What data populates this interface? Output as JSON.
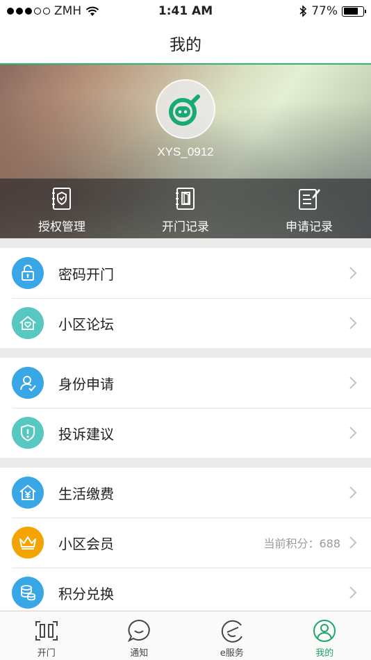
{
  "status_bar": {
    "carrier": "ZMH",
    "time": "1:41 AM",
    "battery": "77%",
    "battery_level": 0.77,
    "signal_bars": 3
  },
  "nav": {
    "title": "我的"
  },
  "profile": {
    "username": "XYS_0912",
    "quick_actions": [
      {
        "label": "授权管理",
        "icon": "auth-manage-icon"
      },
      {
        "label": "开门记录",
        "icon": "door-record-icon"
      },
      {
        "label": "申请记录",
        "icon": "apply-record-icon"
      }
    ]
  },
  "groups": [
    [
      {
        "label": "密码开门",
        "icon": "lock-open-icon",
        "color": "#39a7e6"
      },
      {
        "label": "小区论坛",
        "icon": "home-heart-icon",
        "color": "#57c7c1"
      }
    ],
    [
      {
        "label": "身份申请",
        "icon": "user-check-icon",
        "color": "#39a7e6"
      },
      {
        "label": "投诉建议",
        "icon": "shield-alert-icon",
        "color": "#57c7c1"
      }
    ],
    [
      {
        "label": "生活缴费",
        "icon": "house-yen-icon",
        "color": "#39a7e6"
      },
      {
        "label": "小区会员",
        "icon": "crown-icon",
        "color": "#f5a300",
        "extra": "当前积分：688"
      },
      {
        "label": "积分兑换",
        "icon": "coins-icon",
        "color": "#39a7e6"
      }
    ]
  ],
  "tabs": [
    {
      "label": "开门",
      "icon": "scan-door-icon",
      "active": false
    },
    {
      "label": "通知",
      "icon": "chat-bubble-icon",
      "active": false
    },
    {
      "label": "e服务",
      "icon": "e-service-icon",
      "active": false
    },
    {
      "label": "我的",
      "icon": "user-profile-icon",
      "active": true
    }
  ],
  "colors": {
    "accent": "#1fa36a",
    "nav_border": "#2bb673"
  }
}
